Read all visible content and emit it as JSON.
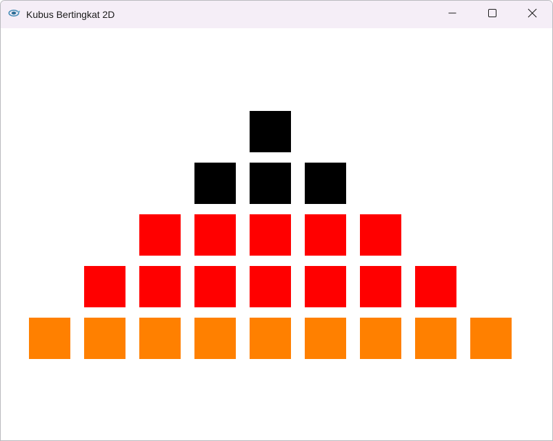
{
  "window": {
    "title": "Kubus Bertingkat 2D",
    "icon": "app-logo-icon",
    "controls": [
      {
        "name": "minimize",
        "icon": "minimize-icon"
      },
      {
        "name": "maximize",
        "icon": "maximize-icon"
      },
      {
        "name": "close",
        "icon": "close-icon"
      }
    ]
  },
  "colors": {
    "black": "#000000",
    "red": "#ff0000",
    "orange": "#ff8000"
  },
  "pyramid": {
    "rows": [
      {
        "tier": 1,
        "count": 1,
        "color": "#000000"
      },
      {
        "tier": 2,
        "count": 3,
        "color": "#000000"
      },
      {
        "tier": 3,
        "count": 5,
        "color": "#ff0000"
      },
      {
        "tier": 4,
        "count": 7,
        "color": "#ff0000"
      },
      {
        "tier": 5,
        "count": 9,
        "color": "#ff8000"
      }
    ]
  }
}
